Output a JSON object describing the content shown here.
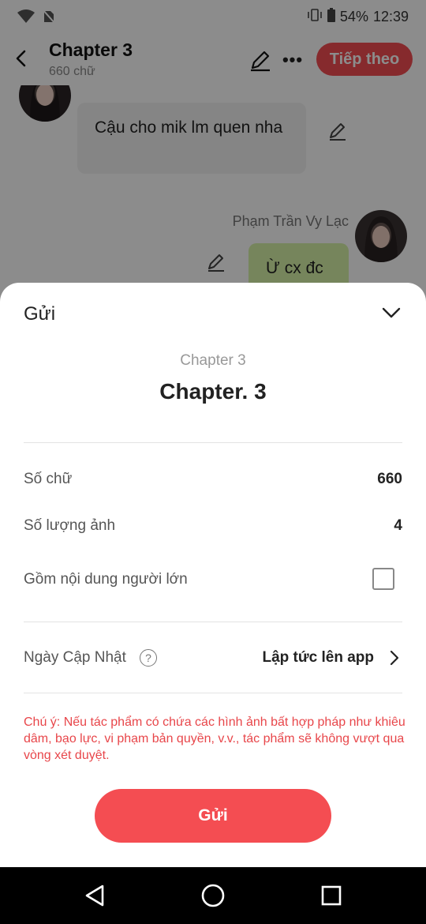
{
  "status_bar": {
    "battery": "54%",
    "time": "12:39"
  },
  "header": {
    "title": "Chapter 3",
    "word_count": "660 chữ",
    "next_label": "Tiếp theo"
  },
  "chat": {
    "left_message": "Cậu cho mik lm quen nha",
    "right_sender": "Phạm Trần Vy Lạc",
    "right_message": "Ừ cx đc"
  },
  "sheet": {
    "title": "Gửi",
    "chapter_label": "Chapter 3",
    "chapter_name": "Chapter. 3",
    "rows": {
      "word_count_label": "Số chữ",
      "word_count_value": "660",
      "image_count_label": "Số lượng ảnh",
      "image_count_value": "4",
      "adult_label": "Gồm nội dung người lớn",
      "adult_checked": false,
      "update_label": "Ngày Cập Nhật",
      "update_value": "Lập tức lên app"
    },
    "notice": "Chú ý: Nếu tác phẩm có chứa các hình ảnh bất hợp pháp như khiêu dâm, bạo lực, vi phạm bản quyền, v.v., tác phẩm sẽ không vượt qua vòng xét duyệt.",
    "send_label": "Gửi"
  },
  "colors": {
    "accent": "#f44d52",
    "notice": "#e8464a"
  }
}
